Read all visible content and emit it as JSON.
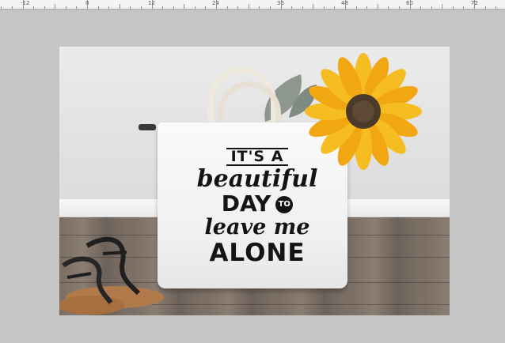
{
  "ruler": {
    "labels": [
      "-12",
      "0",
      "12",
      "24",
      "36",
      "48",
      "60",
      "72"
    ]
  },
  "photo": {
    "quote_lines": [
      "IT'S A",
      "beautiful",
      "DAY",
      "TO",
      "leave me",
      "ALONE"
    ]
  },
  "colors": {
    "workspace": "#c5c5c5",
    "ruler_bg": "#f4f4f4",
    "bag": "#f5f5f5",
    "text": "#141414",
    "petal": "#f3b51a",
    "flower_center": "#4a3a2a",
    "floor": "#7a6e64"
  },
  "icons": {
    "sunflower": "sunflower-icon",
    "leaf": "leaf-icon",
    "sandal": "sandal-icon"
  }
}
